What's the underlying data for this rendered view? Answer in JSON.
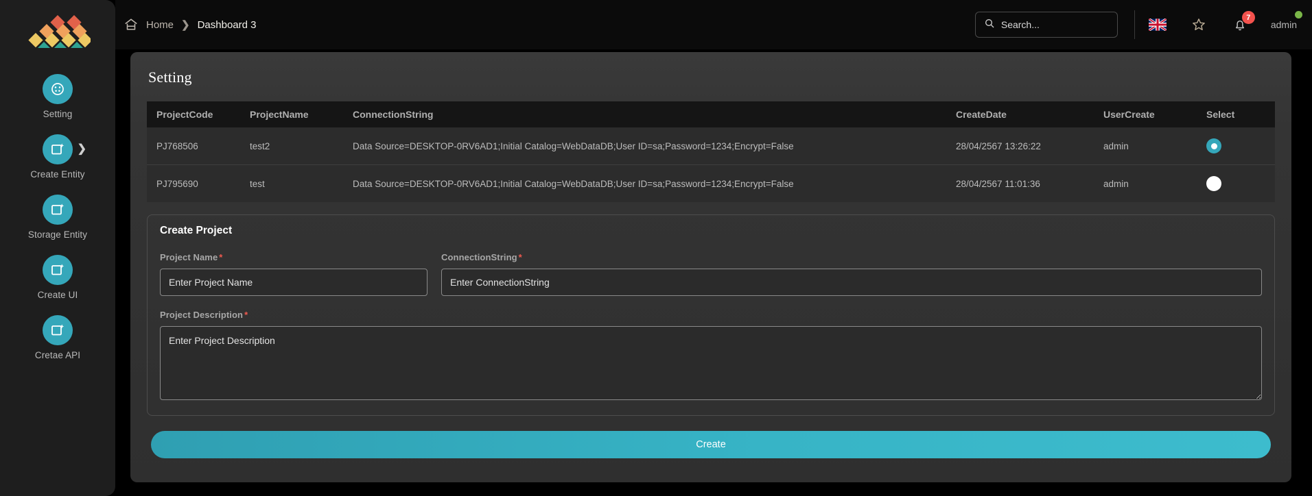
{
  "sidebar": {
    "logo_name": "diamond-mosaic-logo",
    "items": [
      {
        "label": "Setting",
        "icon": "palette-circle-icon",
        "has_chevron": false
      },
      {
        "label": "Create Entity",
        "icon": "image-sparkle-icon",
        "has_chevron": true
      },
      {
        "label": "Storage Entity",
        "icon": "image-sparkle-icon",
        "has_chevron": false
      },
      {
        "label": "Create UI",
        "icon": "image-sparkle-icon",
        "has_chevron": false
      },
      {
        "label": "Cretae API",
        "icon": "image-sparkle-icon",
        "has_chevron": false
      }
    ]
  },
  "topbar": {
    "breadcrumb": {
      "home_label": "Home",
      "separator": "❯",
      "current": "Dashboard 3"
    },
    "search": {
      "placeholder": "Search...",
      "value": "",
      "icon": "search-icon"
    },
    "language_icon": "uk-flag-icon",
    "favorite_icon": "star-icon",
    "notification_icon": "bell-icon",
    "notification_count": "7",
    "username": "admin",
    "status_indicator_color": "#7ab648"
  },
  "panel": {
    "title": "Setting"
  },
  "table": {
    "columns": [
      "ProjectCode",
      "ProjectName",
      "ConnectionString",
      "CreateDate",
      "UserCreate",
      "Select"
    ],
    "rows": [
      {
        "code": "PJ768506",
        "name": "test2",
        "conn": "Data Source=DESKTOP-0RV6AD1;Initial Catalog=WebDataDB;User ID=sa;Password=1234;Encrypt=False",
        "date": "28/04/2567 13:26:22",
        "user": "admin",
        "selected": true
      },
      {
        "code": "PJ795690",
        "name": "test",
        "conn": "Data Source=DESKTOP-0RV6AD1;Initial Catalog=WebDataDB;User ID=sa;Password=1234;Encrypt=False",
        "date": "28/04/2567 11:01:36",
        "user": "admin",
        "selected": false
      }
    ]
  },
  "form": {
    "title": "Create Project",
    "required_mark": "*",
    "project_name": {
      "label": "Project Name",
      "placeholder": "Enter Project Name",
      "value": ""
    },
    "connection": {
      "label": "ConnectionString",
      "placeholder": "Enter ConnectionString",
      "value": ""
    },
    "description": {
      "label": "Project Description",
      "placeholder": "Enter Project Description",
      "value": ""
    },
    "submit_label": "Create"
  },
  "colors": {
    "accent": "#35a7ba",
    "danger": "#f05a4f",
    "badge": "#f4524d",
    "sidebar_bg": "#1e1e1e",
    "panel_bg": "#343434"
  }
}
